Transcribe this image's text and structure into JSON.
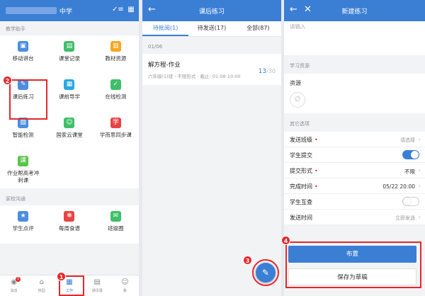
{
  "colors": {
    "brand": "#3b7fd5",
    "highlight": "#e8262a"
  },
  "panel1": {
    "school_suffix": "中学",
    "section_teaching": "教学助手",
    "apps": [
      {
        "label": "移动讲台",
        "icon": "projector-icon",
        "glyph": "▣",
        "color": "#4a8ee0"
      },
      {
        "label": "课堂记录",
        "icon": "record-icon",
        "glyph": "▤",
        "color": "#3fbf6a"
      },
      {
        "label": "教材资源",
        "icon": "textbook-icon",
        "glyph": "▥",
        "color": "#f5a623"
      },
      {
        "label": "课后练习",
        "icon": "homework-icon",
        "glyph": "✎",
        "color": "#4a8ee0"
      },
      {
        "label": "课前导学",
        "icon": "preview-icon",
        "glyph": "▦",
        "color": "#2aa8e0"
      },
      {
        "label": "在线检测",
        "icon": "online-test-icon",
        "glyph": "✓",
        "color": "#3fbf6a"
      },
      {
        "label": "智能检测",
        "icon": "smart-test-icon",
        "glyph": "▧",
        "color": "#4a8ee0"
      },
      {
        "label": "国家云课堂",
        "icon": "cloud-class-icon",
        "glyph": "☺",
        "color": "#3fbf6a"
      },
      {
        "label": "学而思同步课",
        "icon": "xueersi-icon",
        "glyph": "学",
        "color": "#e84343"
      },
      {
        "label": "作业帮高考冲刺课",
        "icon": "zuoyebang-icon",
        "glyph": "课",
        "color": "#5cc24a"
      }
    ],
    "section_home_school": "家校沟通",
    "comm_apps": [
      {
        "label": "学生点评",
        "icon": "student-review-icon",
        "glyph": "★",
        "color": "#4a8ee0"
      },
      {
        "label": "每周食谱",
        "icon": "weekly-menu-icon",
        "glyph": "❋",
        "color": "#e84343"
      },
      {
        "label": "班级圈",
        "icon": "class-circle-icon",
        "glyph": "✉",
        "color": "#3fbf6a"
      }
    ],
    "nav": [
      {
        "label": "消息",
        "icon": "message-icon",
        "glyph": "◉",
        "badge": "1"
      },
      {
        "label": "校园",
        "icon": "campus-icon",
        "glyph": "⌂"
      },
      {
        "label": "工作",
        "icon": "work-icon",
        "glyph": "▦"
      },
      {
        "label": "通讯录",
        "icon": "contacts-icon",
        "glyph": "▤"
      },
      {
        "label": "我",
        "icon": "profile-icon",
        "glyph": "☺"
      }
    ],
    "step1": "1",
    "step2": "2"
  },
  "panel2": {
    "title": "课后练习",
    "tabs": [
      "待批阅(1)",
      "待发送(17)",
      "全部(87)"
    ],
    "date": "01/06",
    "card": {
      "title": "解方程-作业",
      "meta": "六年级(1)班 · 不限形式 · 截止: 01-08 10:00",
      "count": "13",
      "total": "/30"
    },
    "step3": "3"
  },
  "panel3": {
    "title": "新建练习",
    "placeholder": "请输入",
    "section_resources": "学习资源",
    "resources_label": "资源",
    "section_other": "其它选项",
    "rows": [
      {
        "label": "发送班级",
        "required": true,
        "value": "请选择",
        "kind": "link"
      },
      {
        "label": "学生提交",
        "required": false,
        "value": "",
        "kind": "toggle-on"
      },
      {
        "label": "提交形式",
        "required": true,
        "value": "不限",
        "kind": "link-dark"
      },
      {
        "label": "完成时间",
        "required": true,
        "value": "05/22 20:00",
        "kind": "link-dark"
      },
      {
        "label": "学生互查",
        "required": false,
        "value": "",
        "kind": "toggle-off"
      },
      {
        "label": "发送时间",
        "required": false,
        "value": "立即发送",
        "kind": "link"
      }
    ],
    "primary_btn": "布置",
    "secondary_btn": "保存为草稿",
    "step4": "4"
  }
}
